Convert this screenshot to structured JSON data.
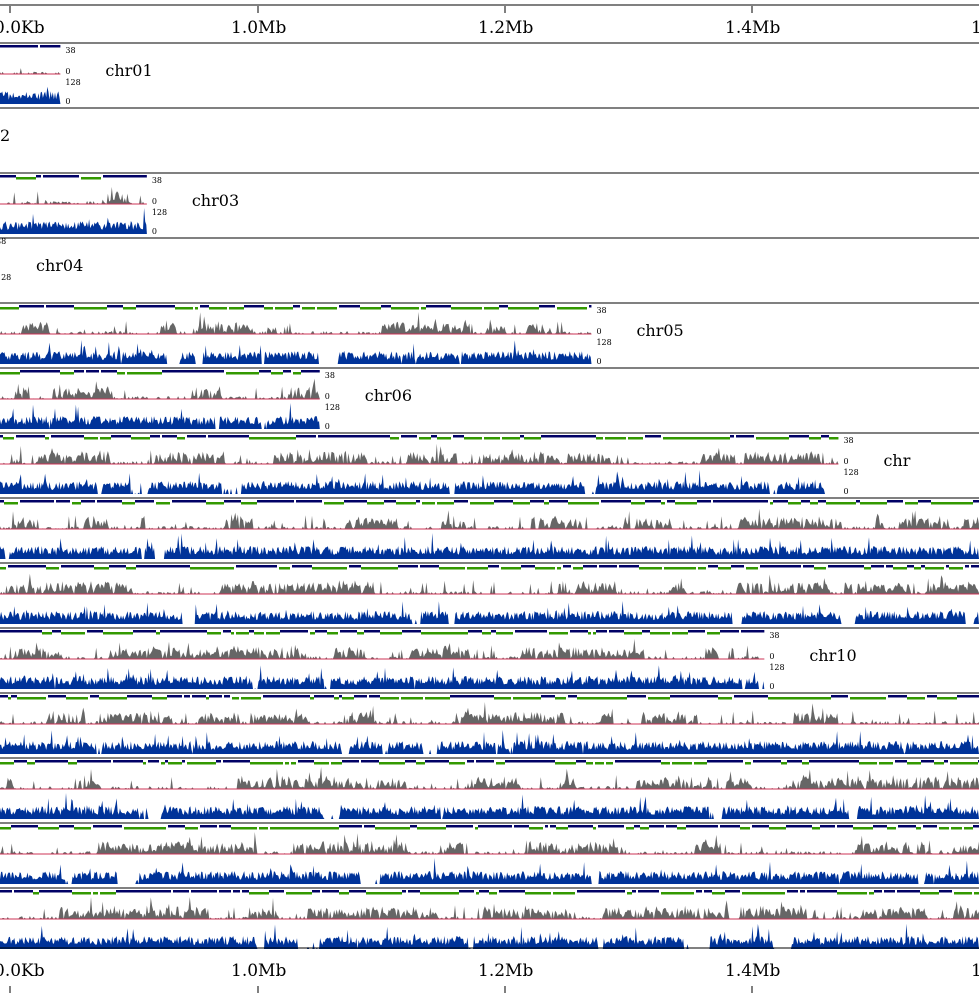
{
  "axis": {
    "tick_labels": [
      "0.0Kb",
      "1.0Mb",
      "1.2Mb",
      "1.4Mb",
      "1"
    ]
  },
  "colors": {
    "coverage": "#003399",
    "signal": "#666666",
    "baseline": "#cc3355",
    "marks_dark": "#000066",
    "marks_green": "#339900",
    "rule": "#000000"
  },
  "chart_data": {
    "type": "area",
    "title": "",
    "xlabel": "",
    "ylabel": "",
    "track_scales": {
      "signal_max": "38",
      "signal_min": "0",
      "coverage_max": "128",
      "coverage_min": "0"
    },
    "chromosomes": [
      {
        "label": "chr01",
        "end_mb": 0.84,
        "has_data": true,
        "show_scale": true
      },
      {
        "label": "2",
        "end_mb": 0.78,
        "has_data": false,
        "show_scale": false
      },
      {
        "label": "chr03",
        "end_mb": 0.91,
        "has_data": true,
        "show_scale": true
      },
      {
        "label": "chr04",
        "end_mb": 0.78,
        "has_data": false,
        "show_scale": true
      },
      {
        "label": "chr05",
        "end_mb": 1.27,
        "has_data": true,
        "show_scale": true
      },
      {
        "label": "chr06",
        "end_mb": 1.05,
        "has_data": true,
        "show_scale": true
      },
      {
        "label": "chr",
        "end_mb": 1.47,
        "has_data": true,
        "show_scale": true
      },
      {
        "label": "",
        "end_mb": 1.6,
        "has_data": true,
        "show_scale": false
      },
      {
        "label": "",
        "end_mb": 1.6,
        "has_data": true,
        "show_scale": false
      },
      {
        "label": "chr10",
        "end_mb": 1.41,
        "has_data": true,
        "show_scale": true
      },
      {
        "label": "",
        "end_mb": 1.6,
        "has_data": true,
        "show_scale": false
      },
      {
        "label": "",
        "end_mb": 1.6,
        "has_data": true,
        "show_scale": false
      },
      {
        "label": "",
        "end_mb": 1.6,
        "has_data": true,
        "show_scale": false
      },
      {
        "label": "",
        "end_mb": 1.6,
        "has_data": true,
        "show_scale": false
      }
    ]
  }
}
